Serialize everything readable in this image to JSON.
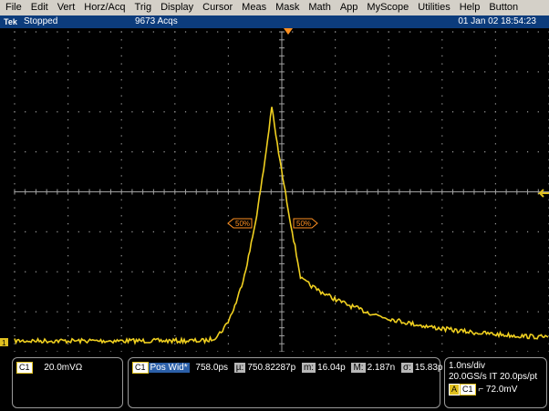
{
  "menu": [
    "File",
    "Edit",
    "Vert",
    "Horz/Acq",
    "Trig",
    "Display",
    "Cursor",
    "Meas",
    "Mask",
    "Math",
    "App",
    "MyScope",
    "Utilities",
    "Help",
    "Button"
  ],
  "status": {
    "logo": "Tek",
    "state": "Stopped",
    "acqs": "9673 Acqs",
    "datetime": "01 Jan 02 18:54:23"
  },
  "screen": {
    "ch1_marker": "1",
    "cursor_left_label": "50%",
    "cursor_right_label": "50%"
  },
  "colors": {
    "trace": "#f0d020",
    "grid": "#a0a0a0",
    "cursor_marker": "#ff9020",
    "status_bg": "#0c3c7c"
  },
  "channel_box": {
    "ch_tag": "C1",
    "scale": "20.0mVΩ"
  },
  "measurement": {
    "ch_tag": "C1",
    "name": "Pos Wid*",
    "value": "758.0ps",
    "mean_label": "µ:",
    "mean": "750.82287p",
    "min_label": "m:",
    "min": "16.04p",
    "max_label": "M:",
    "max": "2.187n",
    "sigma_label": "σ:",
    "sigma": "15.83p"
  },
  "horizontal": {
    "timebase": "1.0ns/div",
    "sample": "20.0GS/s IT 20.0ps/pt",
    "trig_mode": "A",
    "trig_ch": "C1",
    "trig_level": "⌐ 72.0mV"
  }
}
